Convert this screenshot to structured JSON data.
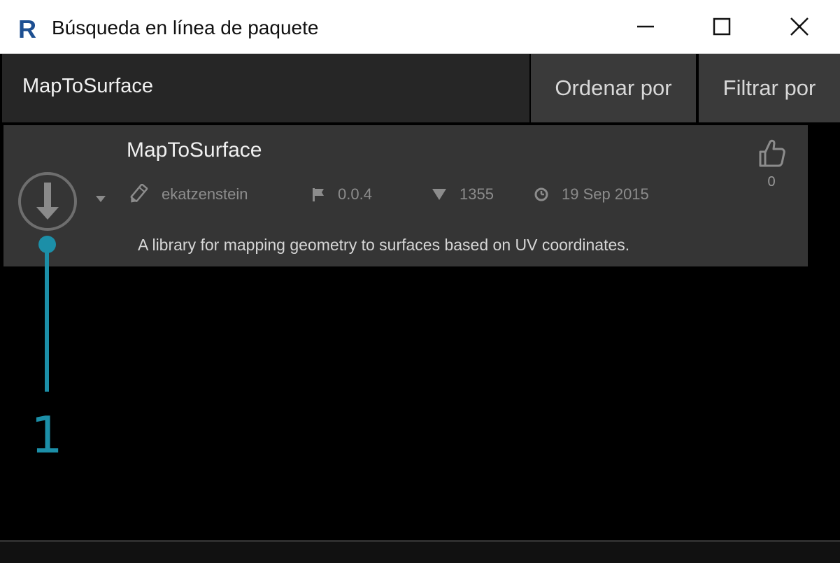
{
  "window": {
    "title": "Búsqueda en línea de paquete",
    "logo_letter": "R"
  },
  "header": {
    "search_value": "MapToSurface",
    "sort_label": "Ordenar por",
    "filter_label": "Filtrar por"
  },
  "package": {
    "name": "MapToSurface",
    "author": "ekatzenstein",
    "version": "0.0.4",
    "downloads": "1355",
    "date": "19 Sep 2015",
    "description": "A library for mapping geometry to surfaces based on UV coordinates.",
    "votes": "0"
  },
  "callout": {
    "number": "1",
    "color": "#1c8fa8"
  },
  "colors": {
    "background": "#000000",
    "header": "#262626",
    "button": "#3a3a3a",
    "card": "#353535"
  }
}
